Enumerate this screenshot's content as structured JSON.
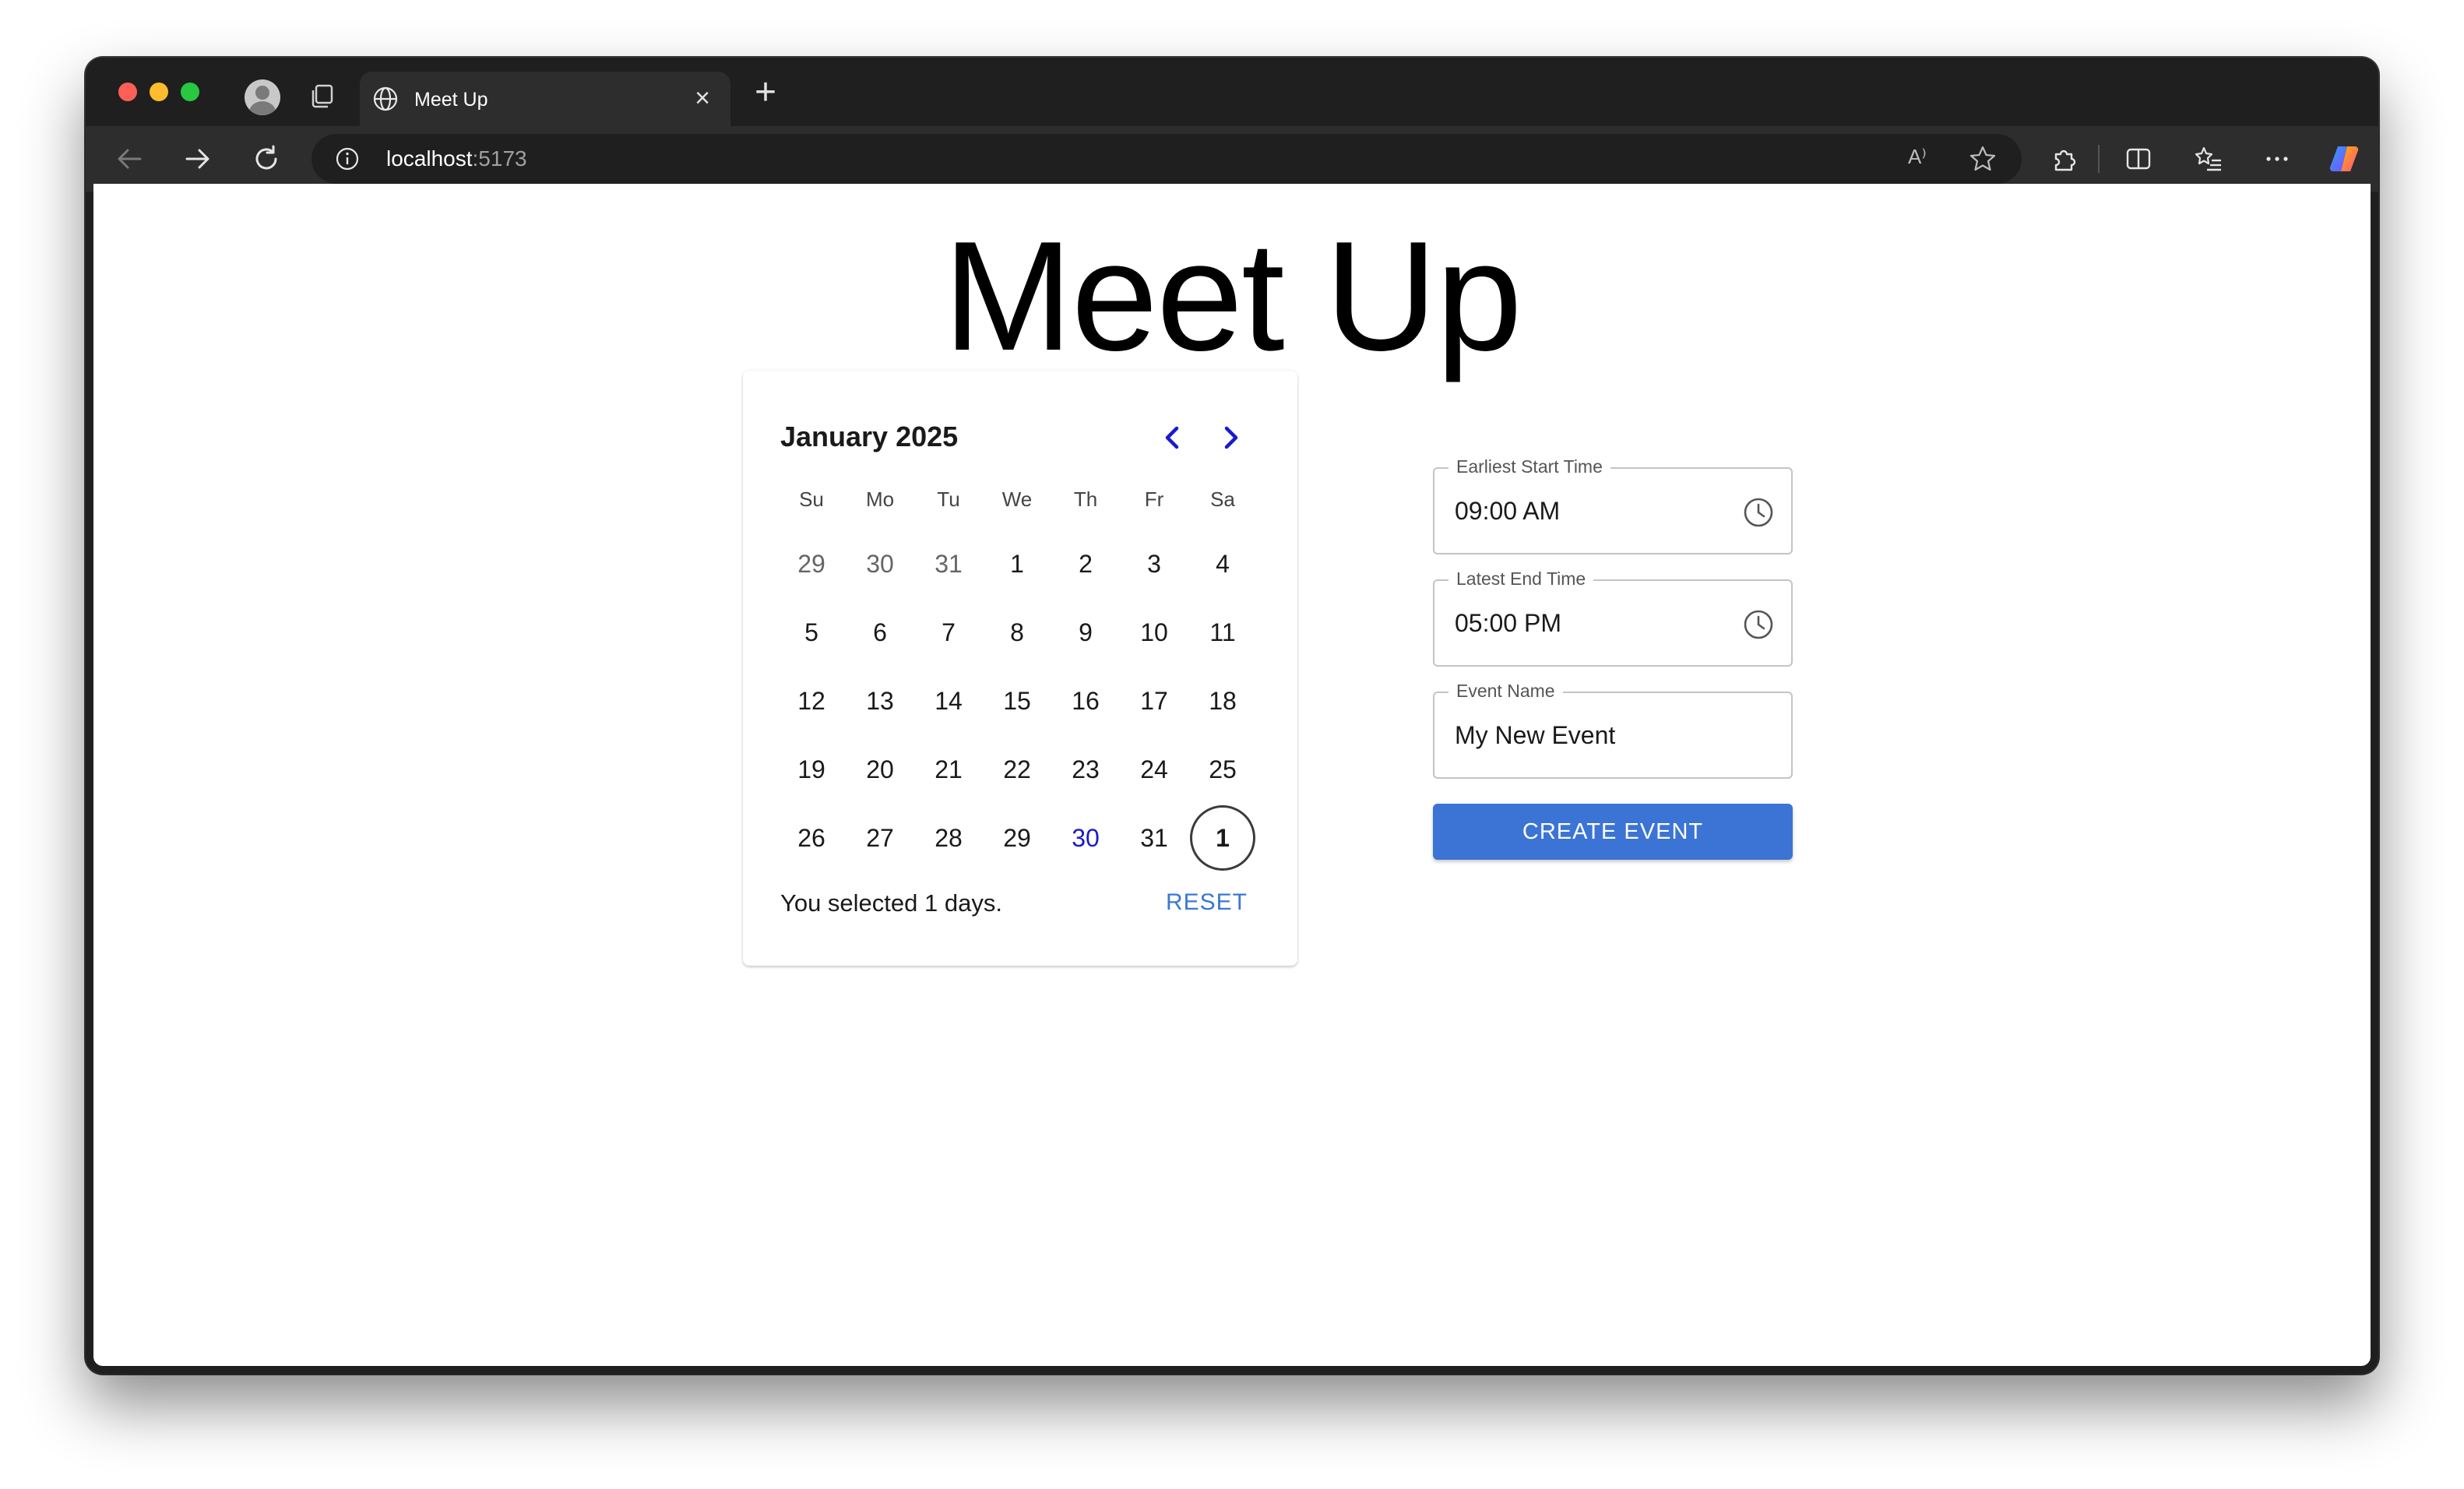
{
  "browser": {
    "tab_title": "Meet Up",
    "url_host": "localhost",
    "url_port": ":5173",
    "read_aloud_label": "A⁾"
  },
  "page": {
    "title": "Meet Up"
  },
  "calendar": {
    "month_label": "January 2025",
    "weekdays": [
      "Su",
      "Mo",
      "Tu",
      "We",
      "Th",
      "Fr",
      "Sa"
    ],
    "weeks": [
      [
        "29",
        "30",
        "31",
        "1",
        "2",
        "3",
        "4"
      ],
      [
        "5",
        "6",
        "7",
        "8",
        "9",
        "10",
        "11"
      ],
      [
        "12",
        "13",
        "14",
        "15",
        "16",
        "17",
        "18"
      ],
      [
        "19",
        "20",
        "21",
        "22",
        "23",
        "24",
        "25"
      ],
      [
        "26",
        "27",
        "28",
        "29",
        "30",
        "31",
        "1"
      ]
    ],
    "outside_days": [
      [
        0,
        0
      ],
      [
        0,
        1
      ],
      [
        0,
        2
      ]
    ],
    "today": [
      4,
      4
    ],
    "selected": [
      4,
      6
    ],
    "selection_text": "You selected 1 days.",
    "reset_label": "RESET"
  },
  "form": {
    "start": {
      "label": "Earliest Start Time",
      "value": "09:00 AM"
    },
    "end": {
      "label": "Latest End Time",
      "value": "05:00 PM"
    },
    "name": {
      "label": "Event Name",
      "value": "My New Event"
    },
    "submit_label": "CREATE EVENT"
  },
  "colors": {
    "accent": "#3b74d4",
    "today_text": "#1a1acc",
    "nav_arrow": "#1a1acc"
  }
}
